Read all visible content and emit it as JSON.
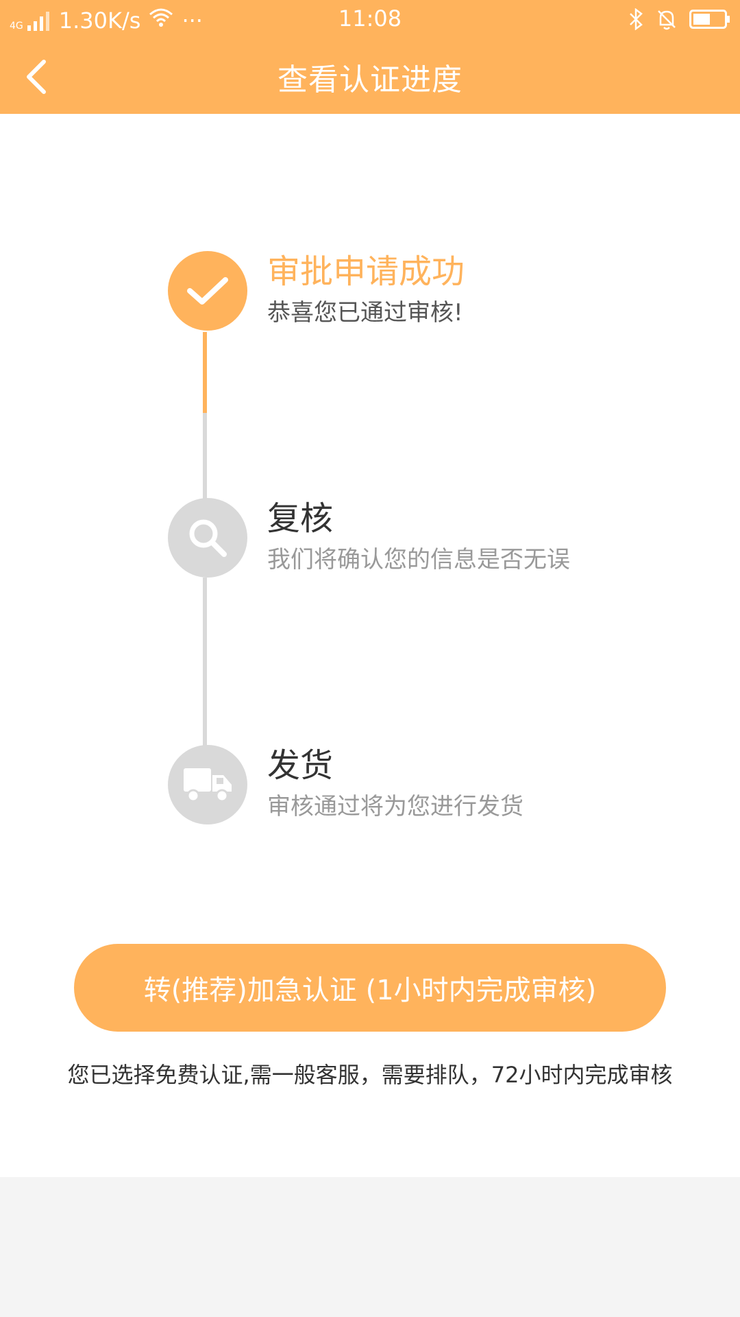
{
  "status_bar": {
    "network": "4G",
    "speed": "1.30K/s",
    "more": "···",
    "time": "11:08"
  },
  "header": {
    "title": "查看认证进度"
  },
  "steps": [
    {
      "title": "审批申请成功",
      "desc": "恭喜您已通过审核!",
      "state": "done",
      "icon": "check-icon"
    },
    {
      "title": "复核",
      "desc": "我们将确认您的信息是否无误",
      "state": "pending",
      "icon": "search-icon"
    },
    {
      "title": "发货",
      "desc": "审核通过将为您进行发货",
      "state": "pending",
      "icon": "truck-icon"
    }
  ],
  "cta": {
    "label": "转(推荐)加急认证 (1小时内完成审核)"
  },
  "note": {
    "text": "您已选择免费认证,需一般客服，需要排队，72小时内完成审核"
  },
  "colors": {
    "accent": "#FFB35C",
    "inactive": "#D9D9D9"
  }
}
